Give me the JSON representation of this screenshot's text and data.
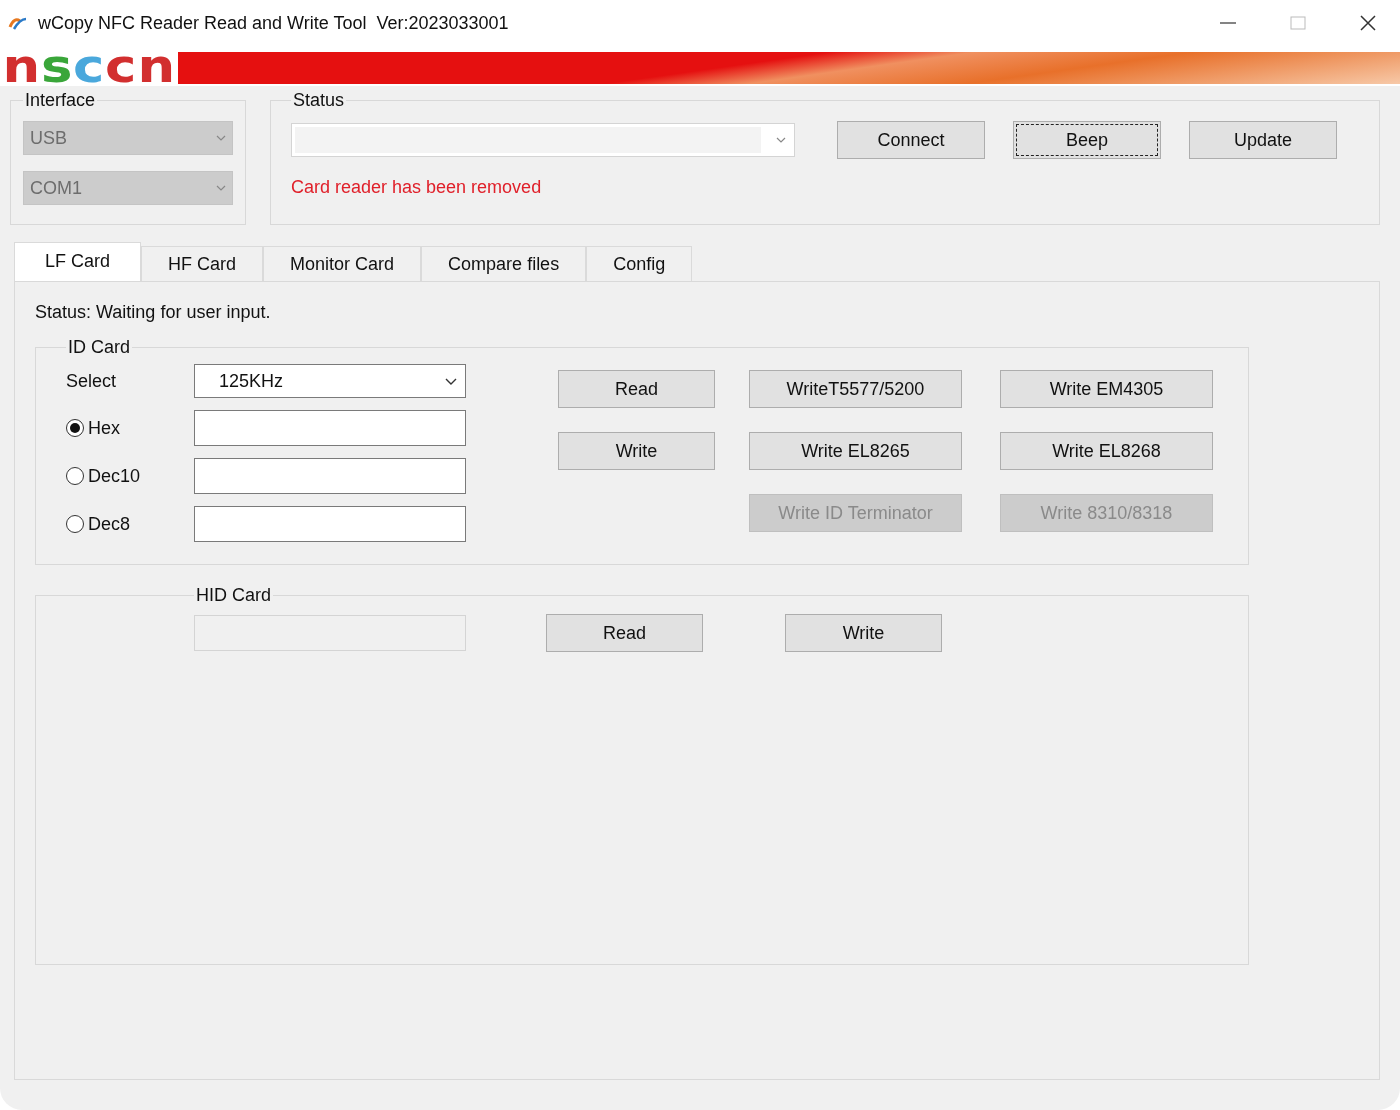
{
  "window": {
    "title": "wCopy NFC Reader Read and Write Tool  Ver:2023033001"
  },
  "logo": {
    "letters": [
      {
        "text": "n",
        "color": "#d22f2f"
      },
      {
        "text": "s",
        "color": "#3aa63a"
      },
      {
        "text": "c",
        "color": "#4aa8dc"
      },
      {
        "text": "c",
        "color": "#d22f2f"
      },
      {
        "text": "n",
        "color": "#d22f2f"
      }
    ]
  },
  "interface": {
    "legend": "Interface",
    "selects": [
      {
        "value": "USB",
        "disabled": true
      },
      {
        "value": "COM1",
        "disabled": true
      }
    ]
  },
  "status": {
    "legend": "Status",
    "message": "Card reader has been removed",
    "buttons": [
      {
        "label": "Connect",
        "focused": false
      },
      {
        "label": "Beep",
        "focused": true
      },
      {
        "label": "Update",
        "focused": false
      }
    ]
  },
  "tabs": [
    {
      "label": "LF Card",
      "selected": true
    },
    {
      "label": "HF Card",
      "selected": false
    },
    {
      "label": "Monitor Card",
      "selected": false
    },
    {
      "label": "Compare files",
      "selected": false
    },
    {
      "label": "Config",
      "selected": false
    }
  ],
  "status_line": "Status: Waiting for user input.",
  "id_card": {
    "legend": "ID Card",
    "select_label": "Select",
    "frequency": "125KHz",
    "formats": [
      {
        "label": "Hex",
        "selected": true
      },
      {
        "label": "Dec10",
        "selected": false
      },
      {
        "label": "Dec8",
        "selected": false
      }
    ],
    "button_columns": [
      [
        {
          "label": "Read",
          "disabled": false
        },
        {
          "label": "Write",
          "disabled": false
        }
      ],
      [
        {
          "label": "WriteT5577/5200",
          "disabled": false
        },
        {
          "label": "Write EL8265",
          "disabled": false
        },
        {
          "label": "Write ID Terminator",
          "disabled": true
        }
      ],
      [
        {
          "label": "Write EM4305",
          "disabled": false
        },
        {
          "label": "Write EL8268",
          "disabled": false
        },
        {
          "label": "Write 8310/8318",
          "disabled": true
        }
      ]
    ]
  },
  "hid_card": {
    "legend": "HID Card",
    "field": {
      "disabled": true
    },
    "buttons": [
      {
        "label": "Read",
        "disabled": false
      },
      {
        "label": "Write",
        "disabled": false
      }
    ]
  }
}
